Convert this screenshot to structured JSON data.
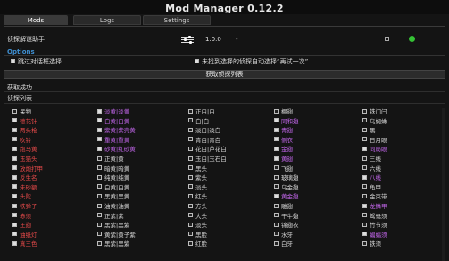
{
  "window": {
    "title": "Mod Manager 0.12.2"
  },
  "tabs": [
    {
      "label": "Mods",
      "active": true
    },
    {
      "label": "Logs",
      "active": false
    },
    {
      "label": "Settings",
      "active": false
    }
  ],
  "mod": {
    "name": "侦探解谜助手",
    "version": "1.0.0",
    "dash": "-",
    "status_color": "#35c235"
  },
  "options": {
    "header": "Options",
    "opt1": "跳过对话框选择",
    "opt2": "未找到选择的侦探自动选择“再试一次”"
  },
  "buttons": {
    "fetch_list": "获取侦探列表"
  },
  "status": {
    "success": "获取成功",
    "list_title": "侦探列表"
  },
  "colors": {
    "accent": "#3e8ed0",
    "red": "#e84a4a",
    "purple": "#c065e8",
    "white": "#d6d6d6"
  },
  "detectives": [
    [
      {
        "name": "呆物",
        "color": "white",
        "checked": false
      },
      {
        "name": "德花针",
        "color": "red",
        "checked": true
      },
      {
        "name": "两头枪",
        "color": "red",
        "checked": true
      },
      {
        "name": "吹铃",
        "color": "red",
        "checked": true
      },
      {
        "name": "跑马黄",
        "color": "red",
        "checked": true
      },
      {
        "name": "玉猫头",
        "color": "red",
        "checked": true
      },
      {
        "name": "放炮打甲",
        "color": "red",
        "checked": true
      },
      {
        "name": "反生名",
        "color": "red",
        "checked": true
      },
      {
        "name": "朱砂额",
        "color": "red",
        "checked": true
      },
      {
        "name": "头陀",
        "color": "red",
        "checked": true
      },
      {
        "name": "铁弹子",
        "color": "red",
        "checked": true
      },
      {
        "name": "赤须",
        "color": "red",
        "checked": true
      },
      {
        "name": "王翅",
        "color": "red",
        "checked": true
      },
      {
        "name": "油纸灯",
        "color": "red",
        "checked": true
      },
      {
        "name": "真三色",
        "color": "red",
        "checked": true
      }
    ],
    [
      {
        "name": "淡黄|淡黄",
        "color": "purple",
        "checked": true
      },
      {
        "name": "白黄|白黄",
        "color": "purple",
        "checked": true
      },
      {
        "name": "紫黄|紫壳黄",
        "color": "purple",
        "checked": true
      },
      {
        "name": "重黄|重黄",
        "color": "purple",
        "checked": true
      },
      {
        "name": "砂黄|红砂黄",
        "color": "purple",
        "checked": true
      },
      {
        "name": "正黄|黄",
        "color": "white",
        "checked": false
      },
      {
        "name": "暗黄|暗黄",
        "color": "white",
        "checked": false
      },
      {
        "name": "纯黄|纯黄",
        "color": "white",
        "checked": false
      },
      {
        "name": "白黄|白黄",
        "color": "white",
        "checked": false
      },
      {
        "name": "黑黄|黑黄",
        "color": "white",
        "checked": false
      },
      {
        "name": "油黄|油黄",
        "color": "white",
        "checked": false
      },
      {
        "name": "正紫|紫",
        "color": "white",
        "checked": false
      },
      {
        "name": "黑紫|黑紫",
        "color": "white",
        "checked": false
      },
      {
        "name": "黄紫|黄子紫",
        "color": "white",
        "checked": false
      },
      {
        "name": "黑紫|黑紫",
        "color": "white",
        "checked": false
      }
    ],
    [
      {
        "name": "正白|白",
        "color": "white",
        "checked": false
      },
      {
        "name": "白|白",
        "color": "white",
        "checked": false
      },
      {
        "name": "淡白|淡白",
        "color": "white",
        "checked": false
      },
      {
        "name": "青白|青白",
        "color": "white",
        "checked": false
      },
      {
        "name": "花白|芦花白",
        "color": "white",
        "checked": false
      },
      {
        "name": "玉白|玉石白",
        "color": "white",
        "checked": false
      },
      {
        "name": "黑头",
        "color": "white",
        "checked": false
      },
      {
        "name": "紫头",
        "color": "white",
        "checked": false
      },
      {
        "name": "淡头",
        "color": "white",
        "checked": false
      },
      {
        "name": "红头",
        "color": "white",
        "checked": false
      },
      {
        "name": "方头",
        "color": "white",
        "checked": false
      },
      {
        "name": "大头",
        "color": "white",
        "checked": false
      },
      {
        "name": "淡头",
        "color": "white",
        "checked": false
      },
      {
        "name": "黑脸",
        "color": "white",
        "checked": false
      },
      {
        "name": "红脸",
        "color": "white",
        "checked": false
      }
    ],
    [
      {
        "name": "棚翅",
        "color": "white",
        "checked": false
      },
      {
        "name": "同和翅",
        "color": "purple",
        "checked": true
      },
      {
        "name": "青翅",
        "color": "purple",
        "checked": true
      },
      {
        "name": "侧衣",
        "color": "purple",
        "checked": true
      },
      {
        "name": "金翅",
        "color": "purple",
        "checked": true
      },
      {
        "name": "黄翅",
        "color": "purple",
        "checked": true
      },
      {
        "name": "飞翅",
        "color": "white",
        "checked": false
      },
      {
        "name": "玻璃翅",
        "color": "white",
        "checked": false
      },
      {
        "name": "乌金翅",
        "color": "white",
        "checked": false
      },
      {
        "name": "黄金翅",
        "color": "purple",
        "checked": true
      },
      {
        "name": "雕翅",
        "color": "white",
        "checked": false
      },
      {
        "name": "干牛翅",
        "color": "white",
        "checked": false
      },
      {
        "name": "锦翅衣",
        "color": "white",
        "checked": false
      },
      {
        "name": "水牙",
        "color": "white",
        "checked": false
      },
      {
        "name": "白牙",
        "color": "white",
        "checked": false
      }
    ],
    [
      {
        "name": "铁门闩",
        "color": "white",
        "checked": false
      },
      {
        "name": "乌蜘蛛",
        "color": "white",
        "checked": false
      },
      {
        "name": "黑",
        "color": "white",
        "checked": false
      },
      {
        "name": "日月眼",
        "color": "white",
        "checked": false
      },
      {
        "name": "同局眼",
        "color": "purple",
        "checked": true
      },
      {
        "name": "三线",
        "color": "white",
        "checked": false
      },
      {
        "name": "六线",
        "color": "white",
        "checked": false
      },
      {
        "name": "八线",
        "color": "purple",
        "checked": true
      },
      {
        "name": "龟甲",
        "color": "white",
        "checked": false
      },
      {
        "name": "金束带",
        "color": "white",
        "checked": false
      },
      {
        "name": "龙鳞甲",
        "color": "purple",
        "checked": true
      },
      {
        "name": "鸳鸯须",
        "color": "white",
        "checked": false
      },
      {
        "name": "竹节须",
        "color": "white",
        "checked": false
      },
      {
        "name": "蝙蝠须",
        "color": "purple",
        "checked": true
      },
      {
        "name": "铁须",
        "color": "white",
        "checked": false
      }
    ]
  ]
}
